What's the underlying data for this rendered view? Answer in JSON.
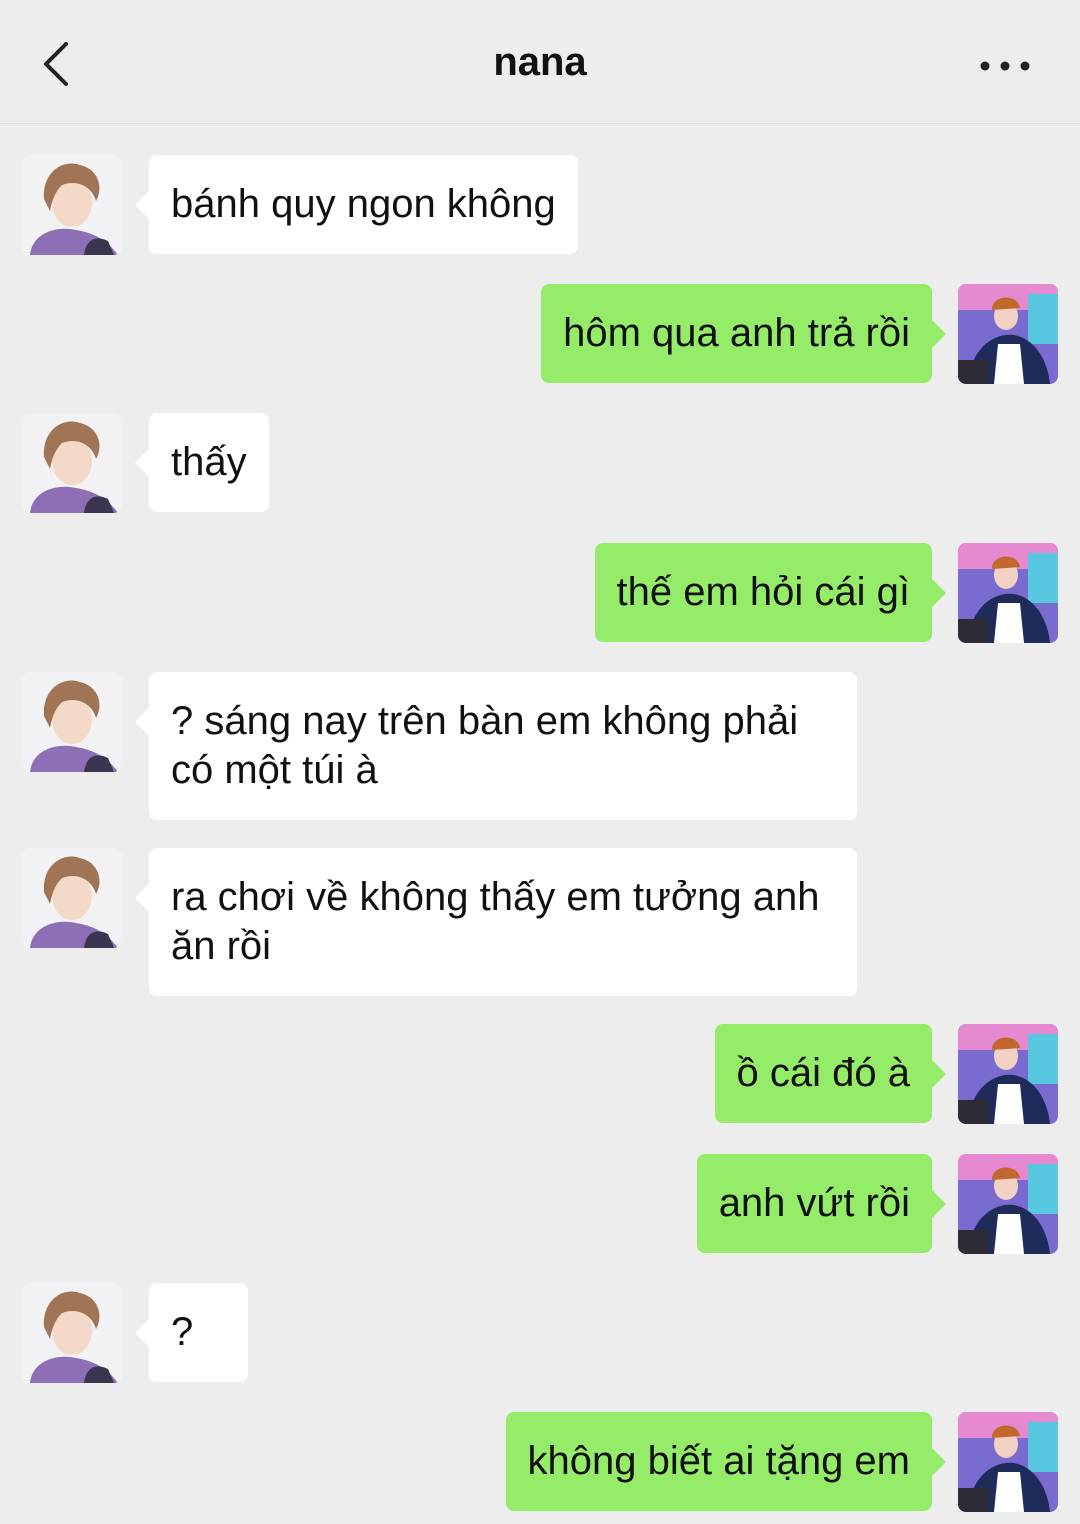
{
  "header": {
    "title": "nana",
    "back_icon": "chevron-left-icon",
    "more_icon": "more-dots-icon"
  },
  "colors": {
    "background": "#ededed",
    "incoming_bubble": "#ffffff",
    "outgoing_bubble": "#95ec69"
  },
  "messages": [
    {
      "side": "left",
      "text": "bánh quy ngon không"
    },
    {
      "side": "right",
      "text": "hôm qua anh trả rồi"
    },
    {
      "side": "left",
      "text": "thấy"
    },
    {
      "side": "right",
      "text": "thế em hỏi cái gì"
    },
    {
      "side": "left",
      "text": "? sáng nay trên bàn em không phải có một túi à"
    },
    {
      "side": "left",
      "text": "ra chơi về không thấy em tưởng anh ăn rồi"
    },
    {
      "side": "right",
      "text": "ồ cái đó à"
    },
    {
      "side": "right",
      "text": "anh vứt rồi"
    },
    {
      "side": "left",
      "text": "?"
    },
    {
      "side": "right",
      "text": "không biết ai tặng em"
    }
  ]
}
